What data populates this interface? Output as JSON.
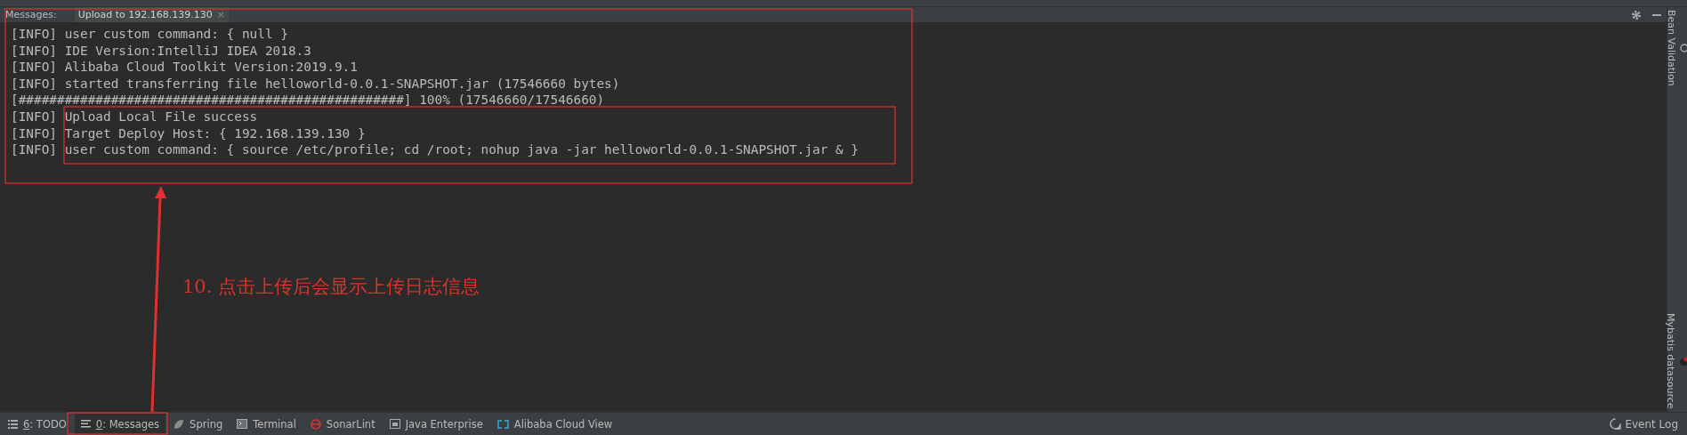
{
  "tool_window": {
    "label": "Messages:",
    "tabs": [
      {
        "label": "Upload to 192.168.139.130",
        "selected": true,
        "close": "×"
      }
    ]
  },
  "console_lines": [
    "[INFO] user custom command: { null }",
    "[INFO] IDE Version:IntelliJ IDEA 2018.3",
    "[INFO] Alibaba Cloud Toolkit Version:2019.9.1",
    "[INFO] started transferring file helloworld-0.0.1-SNAPSHOT.jar (17546660 bytes)",
    "[##################################################] 100% (17546660/17546660)",
    "[INFO] Upload Local File success",
    "[INFO] Target Deploy Host: { 192.168.139.130 }",
    "[INFO] user custom command: { source /etc/profile; cd /root; nohup java -jar helloworld-0.0.1-SNAPSHOT.jar & }"
  ],
  "right_sidebar": [
    {
      "label": "Bean Validation",
      "kind": "bean"
    },
    {
      "label": "Mybatis datasource",
      "kind": "bird"
    }
  ],
  "bottom_tabs": [
    {
      "mnemonic": "6",
      "label": ": TODO",
      "kind": "list",
      "selected": false
    },
    {
      "mnemonic": "0",
      "label": ": Messages",
      "kind": "lines",
      "selected": true
    },
    {
      "label": "Spring",
      "kind": "leaf",
      "selected": false
    },
    {
      "label": "Terminal",
      "kind": "terminal",
      "selected": false
    },
    {
      "label": "SonarLint",
      "kind": "sonar",
      "selected": false
    },
    {
      "label": "Java Enterprise",
      "kind": "enterprise",
      "selected": false
    },
    {
      "label": "Alibaba Cloud View",
      "kind": "cloud",
      "selected": false
    }
  ],
  "event_log": "Event Log",
  "annotation": "10. 点击上传后会显示上传日志信息"
}
